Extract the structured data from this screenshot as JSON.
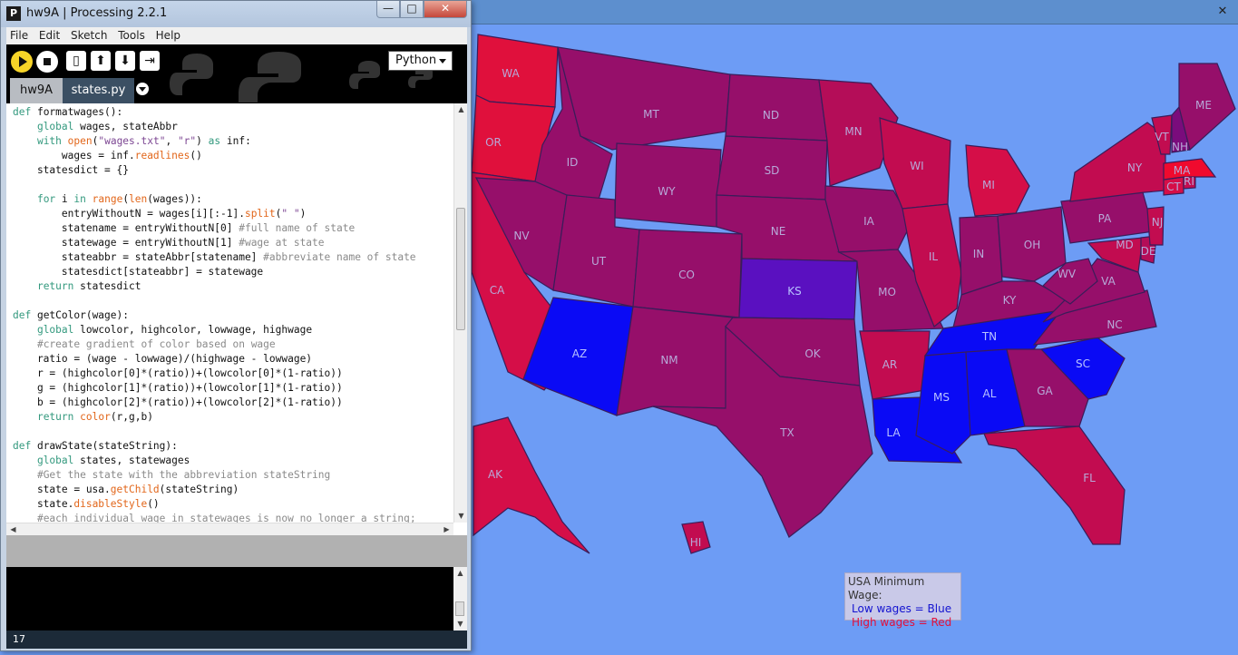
{
  "app": {
    "window_title": "hw9A | Processing 2.2.1",
    "logo_letter": "P"
  },
  "window_controls": {
    "minimize": "—",
    "maximize": "□",
    "close": "✕"
  },
  "menu": [
    "File",
    "Edit",
    "Sketch",
    "Tools",
    "Help"
  ],
  "toolbar": {
    "icons": [
      "run-icon",
      "stop-icon",
      "new-file-icon",
      "open-icon",
      "save-icon",
      "export-icon"
    ],
    "mode": "Python"
  },
  "tabs": [
    {
      "label": "hw9A",
      "active": false
    },
    {
      "label": "states.py",
      "active": true
    }
  ],
  "editor": {
    "lines": [
      "def formatwages():",
      "    global wages, stateAbbr",
      "    with open(\"wages.txt\", \"r\") as inf:",
      "        wages = inf.readlines()",
      "    statesdict = {}",
      "",
      "    for i in range(len(wages)):",
      "        entryWithoutN = wages[i][:-1].split(\" \")",
      "        statename = entryWithoutN[0] #full name of state",
      "        statewage = entryWithoutN[1] #wage at state",
      "        stateabbr = stateAbbr[statename] #abbreviate name of state",
      "        statesdict[stateabbr] = statewage",
      "    return statesdict",
      "",
      "def getColor(wage):",
      "    global lowcolor, highcolor, lowwage, highwage",
      "    #create gradient of color based on wage",
      "    ratio = (wage - lowwage)/(highwage - lowwage)",
      "    r = (highcolor[0]*(ratio))+(lowcolor[0]*(1-ratio))",
      "    g = (highcolor[1]*(ratio))+(lowcolor[1]*(1-ratio))",
      "    b = (highcolor[2]*(ratio))+(lowcolor[2]*(1-ratio))",
      "    return color(r,g,b)",
      "",
      "def drawState(stateString):",
      "    global states, statewages",
      "    #Get the state with the abbreviation stateString",
      "    state = usa.getChild(stateString)",
      "    state.disableStyle()",
      "    #each individual wage in statewages is now no longer a string;"
    ]
  },
  "status": {
    "line_number": "17"
  },
  "legend": {
    "title": "USA Minimum Wage:",
    "low": "Low wages = Blue",
    "high": "High wages = Red"
  },
  "colors": {
    "map_background": "#6d9cf5",
    "high_wage": "#e0103c",
    "mid_high": "#c20c50",
    "mid": "#960f6a",
    "mid_low": "#6f0b8c",
    "kansas": "#5a10c0",
    "low_wage": "#0a0af5"
  },
  "states": [
    {
      "abbr": "WA",
      "color": "#e0103c"
    },
    {
      "abbr": "OR",
      "color": "#e0103c"
    },
    {
      "abbr": "CA",
      "color": "#d50e48"
    },
    {
      "abbr": "NV",
      "color": "#960f6a"
    },
    {
      "abbr": "ID",
      "color": "#960f6a"
    },
    {
      "abbr": "MT",
      "color": "#960f6a"
    },
    {
      "abbr": "WY",
      "color": "#960f6a"
    },
    {
      "abbr": "UT",
      "color": "#960f6a"
    },
    {
      "abbr": "AZ",
      "color": "#0a0af5"
    },
    {
      "abbr": "CO",
      "color": "#960f6a"
    },
    {
      "abbr": "NM",
      "color": "#960f6a"
    },
    {
      "abbr": "ND",
      "color": "#960f6a"
    },
    {
      "abbr": "SD",
      "color": "#960f6a"
    },
    {
      "abbr": "NE",
      "color": "#960f6a"
    },
    {
      "abbr": "KS",
      "color": "#5a10c0"
    },
    {
      "abbr": "OK",
      "color": "#960f6a"
    },
    {
      "abbr": "TX",
      "color": "#960f6a"
    },
    {
      "abbr": "MN",
      "color": "#b40d58"
    },
    {
      "abbr": "IA",
      "color": "#960f6a"
    },
    {
      "abbr": "MO",
      "color": "#960f6a"
    },
    {
      "abbr": "AR",
      "color": "#c20c50"
    },
    {
      "abbr": "LA",
      "color": "#0a0af5"
    },
    {
      "abbr": "WI",
      "color": "#c20c50"
    },
    {
      "abbr": "IL",
      "color": "#c20c50"
    },
    {
      "abbr": "MI",
      "color": "#d50e48"
    },
    {
      "abbr": "IN",
      "color": "#960f6a"
    },
    {
      "abbr": "OH",
      "color": "#960f6a"
    },
    {
      "abbr": "KY",
      "color": "#960f6a"
    },
    {
      "abbr": "TN",
      "color": "#0a0af5"
    },
    {
      "abbr": "MS",
      "color": "#0a0af5"
    },
    {
      "abbr": "AL",
      "color": "#0a0af5"
    },
    {
      "abbr": "GA",
      "color": "#960f6a"
    },
    {
      "abbr": "FL",
      "color": "#c20c50"
    },
    {
      "abbr": "SC",
      "color": "#0a0af5"
    },
    {
      "abbr": "NC",
      "color": "#960f6a"
    },
    {
      "abbr": "VA",
      "color": "#960f6a"
    },
    {
      "abbr": "WV",
      "color": "#960f6a"
    },
    {
      "abbr": "PA",
      "color": "#960f6a"
    },
    {
      "abbr": "MD",
      "color": "#c20c50"
    },
    {
      "abbr": "DE",
      "color": "#b40d58"
    },
    {
      "abbr": "NJ",
      "color": "#c20c50"
    },
    {
      "abbr": "NY",
      "color": "#c20c50"
    },
    {
      "abbr": "CT",
      "color": "#d50e48"
    },
    {
      "abbr": "RI",
      "color": "#c20c50"
    },
    {
      "abbr": "MA",
      "color": "#f00a2e"
    },
    {
      "abbr": "VT",
      "color": "#c20c50"
    },
    {
      "abbr": "NH",
      "color": "#7a0c7c"
    },
    {
      "abbr": "ME",
      "color": "#960f6a"
    },
    {
      "abbr": "AK",
      "color": "#d50e48"
    },
    {
      "abbr": "HI",
      "color": "#c20c50"
    }
  ]
}
